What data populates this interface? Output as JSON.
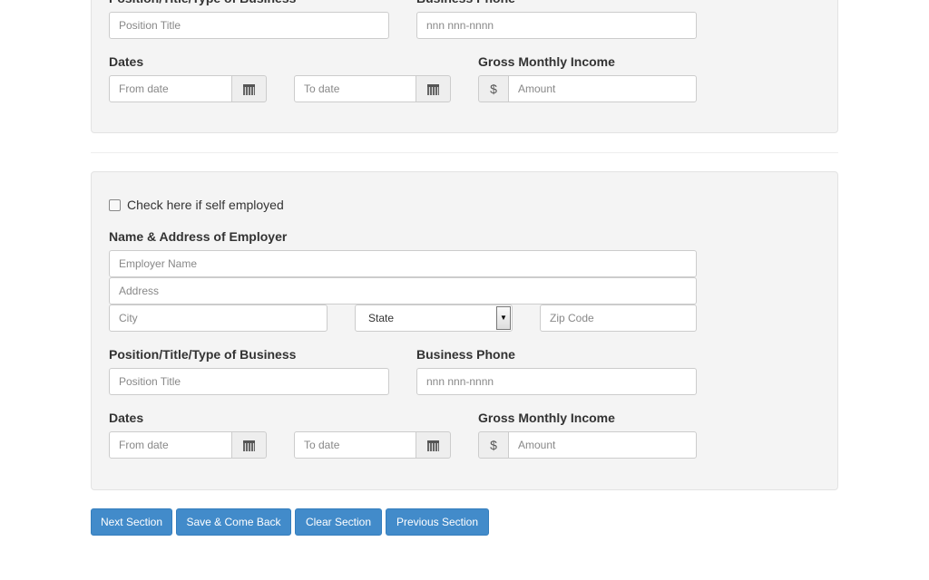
{
  "labels": {
    "position": "Position/Title/Type of Business",
    "phone": "Business Phone",
    "dates": "Dates",
    "income": "Gross Monthly Income",
    "employer": "Name & Address of Employer",
    "self_employed": "Check here if self employed"
  },
  "placeholders": {
    "position": "Position Title",
    "phone": "nnn nnn-nnnn",
    "from": "From date",
    "to": "To date",
    "amount": "Amount",
    "employer": "Employer Name",
    "address": "Address",
    "city": "City",
    "state": "State",
    "zip": "Zip Code"
  },
  "currency": "$",
  "icons": {
    "calendar": "calendar-icon",
    "select": "chevron-down-icon"
  },
  "buttons": {
    "next": "Next Section",
    "save": "Save & Come Back",
    "clear": "Clear Section",
    "previous": "Previous Section"
  },
  "colors": {
    "primary": "#428bca"
  }
}
